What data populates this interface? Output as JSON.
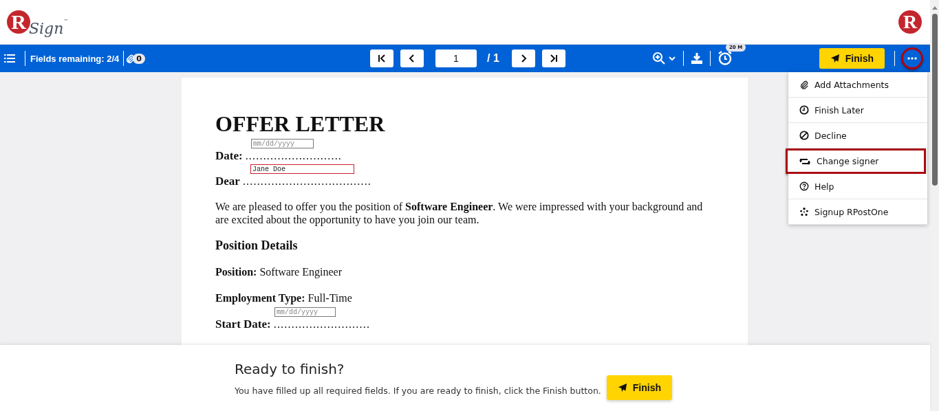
{
  "header": {
    "logo": {
      "letter": "R",
      "word": "Sign",
      "mark": "™"
    },
    "badge_letter": "R"
  },
  "toolbar": {
    "fields_label": "Fields remaining:",
    "fields_count": "2/4",
    "attachments_count": "0",
    "page": "1",
    "page_total": "/ 1",
    "timer": "20 M",
    "finish": "Finish"
  },
  "more_button": {
    "highlighted": true
  },
  "menu": {
    "items": [
      {
        "kind": "paperclip",
        "label": "Add Attachments",
        "highlighted": false
      },
      {
        "kind": "clock",
        "label": "Finish Later",
        "highlighted": false
      },
      {
        "kind": "ban",
        "label": "Decline",
        "highlighted": false
      },
      {
        "kind": "swap",
        "label": "Change signer",
        "highlighted": true
      },
      {
        "kind": "help",
        "label": "Help",
        "highlighted": false
      },
      {
        "kind": "spark",
        "label": "Signup RPostOne",
        "highlighted": false
      }
    ]
  },
  "document": {
    "title": "OFFER LETTER",
    "blocks": [
      {
        "kind": "field-line",
        "label": "Date:",
        "leader": "...........................",
        "field": {
          "placeholder": "mm/dd/yyyy",
          "invalid": false
        }
      },
      {
        "kind": "field-line",
        "label": "Dear",
        "leader": "....................................",
        "field": {
          "value": "Jane Doe",
          "invalid": true
        }
      },
      {
        "kind": "paragraph",
        "text": "We are pleased to offer you the position of **Software Engineer**. We were impressed with your background and are excited about the opportunity to have you join our team."
      },
      {
        "kind": "heading",
        "text": "Position Details"
      },
      {
        "kind": "detail",
        "label": "Position:",
        "value": "Software Engineer"
      },
      {
        "kind": "detail",
        "label": "Employment Type:",
        "value": "Full-Time"
      },
      {
        "kind": "field-line",
        "label": "Start Date:",
        "leader": "...........................",
        "field": {
          "placeholder": "mm/dd/yyyy",
          "invalid": false
        }
      }
    ]
  },
  "footer": {
    "title": "Ready to finish?",
    "message": "You have filled up all required fields. If you are ready to finish, click the Finish button.",
    "button": "Finish"
  }
}
